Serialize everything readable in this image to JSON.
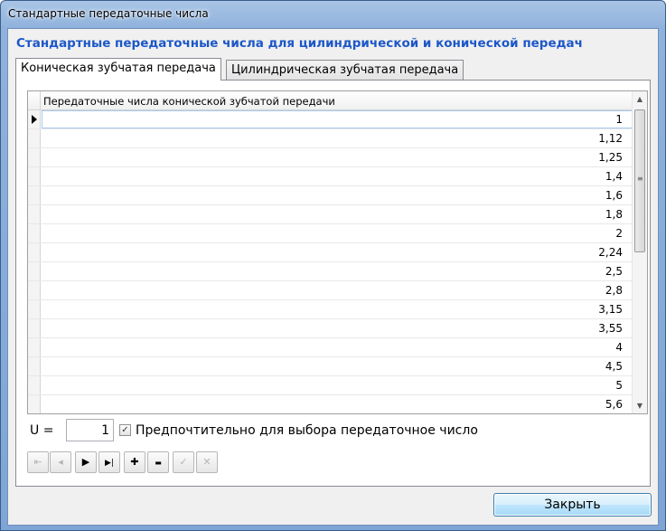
{
  "window": {
    "title": "Стандартные передаточные числа"
  },
  "heading": "Стандартные передаточные числа для цилиндрической и конической передач",
  "tabs": [
    {
      "label": "Коническая зубчатая передача",
      "active": true
    },
    {
      "label": "Цилиндрическая зубчатая передача",
      "active": false
    }
  ],
  "grid": {
    "column_header": "Передаточные числа конической зубчатой передачи",
    "rows": [
      "1",
      "1,12",
      "1,25",
      "1,4",
      "1,6",
      "1,8",
      "2",
      "2,24",
      "2,5",
      "2,8",
      "3,15",
      "3,55",
      "4",
      "4,5",
      "5",
      "5,6"
    ]
  },
  "u_field": {
    "label": "U =",
    "value": "1"
  },
  "preferred": {
    "checked": true,
    "label": "Предпочтительно для выбора передаточное число"
  },
  "navigator": {
    "first": "⇤",
    "prev": "◂",
    "next": "▶",
    "last": "▶|",
    "add": "✚",
    "delete": "▬",
    "post": "✓",
    "cancel": "✕"
  },
  "close_button": {
    "label": "Закрыть"
  },
  "scroll_icons": {
    "up": "▲",
    "down": "▼",
    "grip": "≡"
  }
}
